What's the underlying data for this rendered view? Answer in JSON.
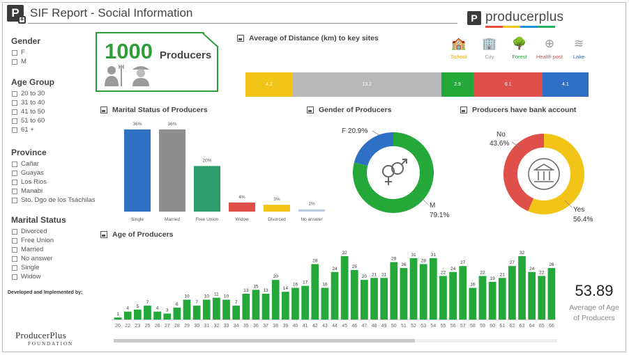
{
  "header": {
    "logo_letter": "P",
    "title": "SIF Report - Social Information",
    "brand": "producerplus",
    "brand_colors": [
      "#e74c3c",
      "#f1c40f",
      "#1f8fd6",
      "#27ae60"
    ]
  },
  "filters": {
    "gender": {
      "title": "Gender",
      "items": [
        "F",
        "M"
      ]
    },
    "age_group": {
      "title": "Age Group",
      "items": [
        "20 to 30",
        "31 to 40",
        "41 to 50",
        "51 to 60",
        "61 +"
      ]
    },
    "province": {
      "title": "Province",
      "items": [
        "Cañar",
        "Guayas",
        "Los Rios",
        "Manabi",
        "Sto. Dgo de los Tsáchilas"
      ]
    },
    "marital_status": {
      "title": "Marital Status",
      "items": [
        "Divorced",
        "Free Union",
        "Married",
        "No answer",
        "Single",
        "Widow"
      ]
    }
  },
  "developed_by": "Developed and Implemented by;",
  "foundation": {
    "line1": "ProducerPlus",
    "line2": "FOUNDATION"
  },
  "kpi": {
    "number": "1000",
    "label": "Producers"
  },
  "distance": {
    "title": "Average of Distance (km) to key sites",
    "poi": [
      {
        "name": "School",
        "icon": "school-icon",
        "glyph": "🏫",
        "color": "#e6a817"
      },
      {
        "name": "City",
        "icon": "city-icon",
        "glyph": "🏢",
        "color": "#9a9a9a"
      },
      {
        "name": "Forest",
        "icon": "forest-icon",
        "glyph": "🌳",
        "color": "#2e9d3a"
      },
      {
        "name": "Health post",
        "icon": "health-post-icon",
        "glyph": "⊕",
        "color": "#e04b3f"
      },
      {
        "name": "Lake",
        "icon": "lake-icon",
        "glyph": "≋",
        "color": "#2a6fc0"
      }
    ],
    "segments": [
      {
        "label": "4.2",
        "value": 4.2,
        "color": "#f2c418"
      },
      {
        "label": "13.2",
        "value": 13.2,
        "color": "#b8b8b8"
      },
      {
        "label": "2.9",
        "value": 2.9,
        "color": "#25a83a"
      },
      {
        "label": "6.1",
        "value": 6.1,
        "color": "#e0504a"
      },
      {
        "label": "4.1",
        "value": 4.1,
        "color": "#2f6fc4"
      }
    ]
  },
  "marital": {
    "title": "Marital Status of Producers",
    "categories": [
      "Single",
      "Married",
      "Free Union",
      "Widow",
      "Divorced",
      "No answer"
    ],
    "values": [
      36,
      36,
      20,
      4,
      3,
      1
    ],
    "labels": [
      "36%",
      "36%",
      "20%",
      "4%",
      "3%",
      "1%"
    ],
    "colors": [
      "#2f6fc4",
      "#8e8e8e",
      "#2e9d6b",
      "#e0504a",
      "#f2c418",
      "#b9c9e4"
    ]
  },
  "gender": {
    "title": "Gender of Producers",
    "slices": [
      {
        "name": "F",
        "label": "F 20.9%",
        "value": 20.9,
        "color": "#2f6fc4"
      },
      {
        "name": "M",
        "label_name": "M",
        "label_value": "79.1%",
        "value": 79.1,
        "color": "#25a83a"
      }
    ],
    "center_icon": "gender-symbol-icon"
  },
  "bank": {
    "title": "Producers have bank account",
    "slices": [
      {
        "name": "No",
        "value_label": "43.6%",
        "value": 43.6,
        "color": "#e0504a"
      },
      {
        "name": "Yes",
        "value_label": "56.4%",
        "value": 56.4,
        "color": "#f2c418"
      }
    ],
    "center_icon": "bank-icon"
  },
  "age": {
    "title": "Age of Producers",
    "avg_value": "53.89",
    "avg_label_1": "Average of Age",
    "avg_label_2": "of Producers"
  },
  "chart_data": [
    {
      "type": "bar",
      "title": "Age of Producers",
      "categories": [
        20,
        22,
        23,
        25,
        26,
        27,
        28,
        29,
        30,
        31,
        32,
        33,
        34,
        35,
        36,
        37,
        38,
        39,
        40,
        41,
        42,
        43,
        44,
        45,
        46,
        47,
        48,
        49,
        50,
        51,
        52,
        53,
        54,
        55,
        56,
        57,
        58,
        59,
        60,
        61,
        62,
        63,
        64,
        65,
        66
      ],
      "values": [
        1,
        4,
        5,
        7,
        4,
        3,
        6,
        10,
        7,
        10,
        11,
        10,
        7,
        13,
        15,
        13,
        20,
        14,
        16,
        17,
        28,
        16,
        24,
        32,
        25,
        20,
        21,
        21,
        29,
        26,
        31,
        28,
        31,
        22,
        24,
        27,
        16,
        22,
        19,
        21,
        27,
        32,
        24,
        22,
        26
      ],
      "color": "#25a83a"
    },
    {
      "type": "bar",
      "title": "Marital Status of Producers",
      "categories": [
        "Single",
        "Married",
        "Free Union",
        "Widow",
        "Divorced",
        "No answer"
      ],
      "values": [
        36,
        36,
        20,
        4,
        3,
        1
      ]
    },
    {
      "type": "pie",
      "title": "Gender of Producers",
      "categories": [
        "F",
        "M"
      ],
      "values": [
        20.9,
        79.1
      ]
    },
    {
      "type": "pie",
      "title": "Producers have bank account",
      "categories": [
        "No",
        "Yes"
      ],
      "values": [
        43.6,
        56.4
      ]
    }
  ]
}
